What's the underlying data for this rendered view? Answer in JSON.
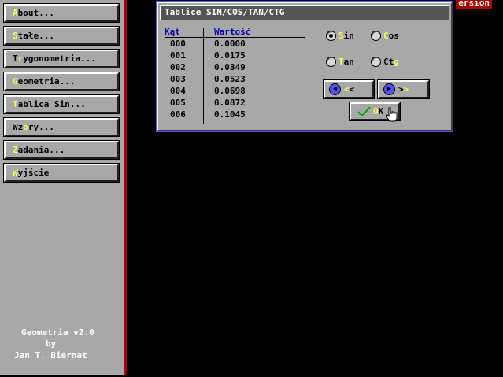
{
  "menu": {
    "items": [
      {
        "hotkey": "A",
        "label": "bout..."
      },
      {
        "hotkey": "S",
        "label": "tałe..."
      },
      {
        "pre": "T",
        "hotkey": "r",
        "label": "ygonometria..."
      },
      {
        "hotkey": "G",
        "label": "eometria..."
      },
      {
        "hotkey": "T",
        "label": "ablica Sin..."
      },
      {
        "pre": "Wz",
        "hotkey": "o",
        "label": "ry..."
      },
      {
        "hotkey": "Z",
        "label": "adania..."
      },
      {
        "hotkey": "W",
        "label": "yjście"
      }
    ]
  },
  "credits": {
    "line1": "Geometria v2.0",
    "line2": "by",
    "line3": "Jan T. Biernat"
  },
  "version_tag": "ersion",
  "dialog": {
    "title": "Tablice SIN/COS/TAN/CTG",
    "col_angle": "Kąt",
    "col_value": "Wartość",
    "rows": [
      {
        "angle": "000",
        "value": "0.0000"
      },
      {
        "angle": "001",
        "value": "0.0175"
      },
      {
        "angle": "002",
        "value": "0.0349"
      },
      {
        "angle": "003",
        "value": "0.0523"
      },
      {
        "angle": "004",
        "value": "0.0698"
      },
      {
        "angle": "005",
        "value": "0.0872"
      },
      {
        "angle": "006",
        "value": "0.1045"
      }
    ],
    "radios": {
      "sin": {
        "hotkey": "S",
        "label": "in",
        "selected": true
      },
      "cos": {
        "hotkey": "C",
        "label": "os",
        "selected": false
      },
      "tan": {
        "hotkey": "T",
        "label": "an",
        "selected": false
      },
      "ctg": {
        "pre": "Ct",
        "hotkey": "g",
        "label": "",
        "selected": false
      }
    },
    "prev_button": {
      "hotkey": "<",
      "label": "<"
    },
    "next_button": {
      "pre": ">",
      "hotkey": ">",
      "label": ""
    },
    "ok_button": {
      "hotkey": "O",
      "label": "K"
    }
  },
  "colors": {
    "accent_hotkey": "#fcfc54",
    "title_bar": "#545454",
    "panel": "#a8a8a8",
    "header_text": "#0000a8",
    "sidebar_border": "#a80000"
  }
}
